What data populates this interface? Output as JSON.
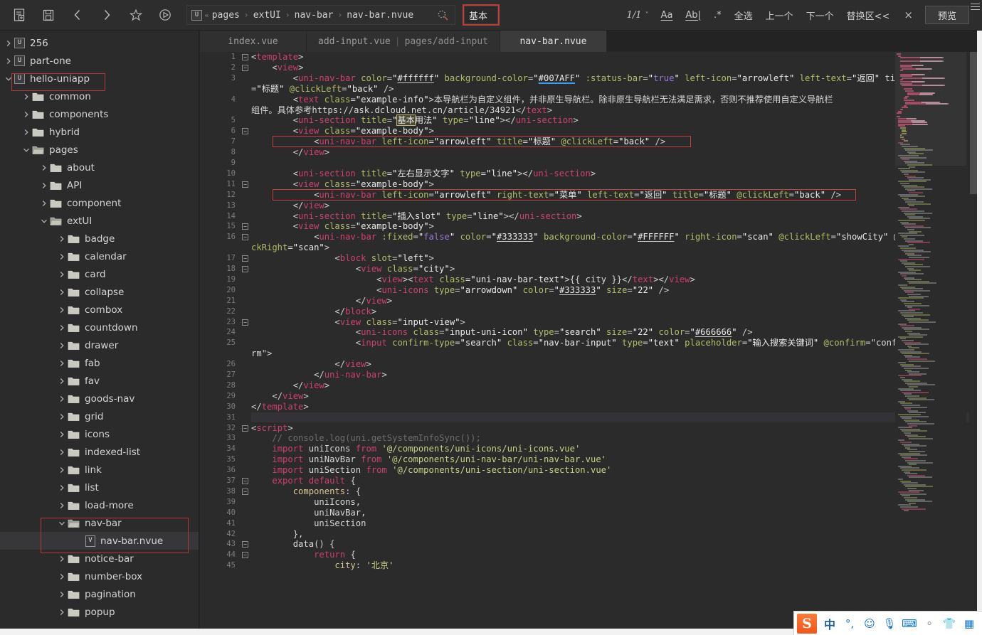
{
  "toolbar": {
    "icons": [
      {
        "name": "new-file-icon",
        "label": "新建"
      },
      {
        "name": "save-icon",
        "label": "保存"
      },
      {
        "name": "back-icon",
        "label": "后退"
      },
      {
        "name": "forward-icon",
        "label": "前进"
      },
      {
        "name": "star-icon",
        "label": "收藏"
      },
      {
        "name": "run-icon",
        "label": "运行"
      }
    ],
    "breadcrumb": {
      "logo": "U",
      "chevron": "«",
      "segments": [
        "pages",
        "extUI",
        "nav-bar",
        "nav-bar.nvue"
      ],
      "separator": "›",
      "search_icon": "search-icon"
    },
    "find": {
      "value": "基本",
      "placeholder": "",
      "match_count": "1/1",
      "caret": "˅",
      "case_label": "Aa",
      "word_label": "Ab|",
      "regex_label": ".*",
      "select_all_label": "全选",
      "prev_label": "上一个",
      "next_label": "下一个",
      "replace_label": "替换区<<",
      "close_label": "×"
    },
    "preview_label": "预览"
  },
  "tabs": [
    {
      "label": "index.vue",
      "active": false,
      "sub": ""
    },
    {
      "label": "add-input.vue",
      "active": false,
      "sub": "pages/add-input",
      "sep": "|"
    },
    {
      "label": "nav-bar.nvue",
      "active": true,
      "sub": ""
    }
  ],
  "sidebar": {
    "items": [
      {
        "label": "256",
        "depth": 0,
        "type": "project",
        "state": "collapsed"
      },
      {
        "label": "part-one",
        "depth": 0,
        "type": "project",
        "state": "collapsed"
      },
      {
        "label": "hello-uniapp",
        "depth": 0,
        "type": "project",
        "state": "expanded",
        "boxed": true
      },
      {
        "label": "common",
        "depth": 1,
        "type": "folder",
        "state": "collapsed"
      },
      {
        "label": "components",
        "depth": 1,
        "type": "folder",
        "state": "collapsed"
      },
      {
        "label": "hybrid",
        "depth": 1,
        "type": "folder",
        "state": "collapsed"
      },
      {
        "label": "pages",
        "depth": 1,
        "type": "folder",
        "state": "expanded"
      },
      {
        "label": "about",
        "depth": 2,
        "type": "folder",
        "state": "collapsed"
      },
      {
        "label": "API",
        "depth": 2,
        "type": "folder",
        "state": "collapsed"
      },
      {
        "label": "component",
        "depth": 2,
        "type": "folder",
        "state": "collapsed"
      },
      {
        "label": "extUI",
        "depth": 2,
        "type": "folder",
        "state": "expanded"
      },
      {
        "label": "badge",
        "depth": 3,
        "type": "folder",
        "state": "collapsed"
      },
      {
        "label": "calendar",
        "depth": 3,
        "type": "folder",
        "state": "collapsed"
      },
      {
        "label": "card",
        "depth": 3,
        "type": "folder",
        "state": "collapsed"
      },
      {
        "label": "collapse",
        "depth": 3,
        "type": "folder",
        "state": "collapsed"
      },
      {
        "label": "combox",
        "depth": 3,
        "type": "folder",
        "state": "collapsed"
      },
      {
        "label": "countdown",
        "depth": 3,
        "type": "folder",
        "state": "collapsed"
      },
      {
        "label": "drawer",
        "depth": 3,
        "type": "folder",
        "state": "collapsed"
      },
      {
        "label": "fab",
        "depth": 3,
        "type": "folder",
        "state": "collapsed"
      },
      {
        "label": "fav",
        "depth": 3,
        "type": "folder",
        "state": "collapsed"
      },
      {
        "label": "goods-nav",
        "depth": 3,
        "type": "folder",
        "state": "collapsed"
      },
      {
        "label": "grid",
        "depth": 3,
        "type": "folder",
        "state": "collapsed"
      },
      {
        "label": "icons",
        "depth": 3,
        "type": "folder",
        "state": "collapsed"
      },
      {
        "label": "indexed-list",
        "depth": 3,
        "type": "folder",
        "state": "collapsed"
      },
      {
        "label": "link",
        "depth": 3,
        "type": "folder",
        "state": "collapsed"
      },
      {
        "label": "list",
        "depth": 3,
        "type": "folder",
        "state": "collapsed"
      },
      {
        "label": "load-more",
        "depth": 3,
        "type": "folder",
        "state": "collapsed"
      },
      {
        "label": "nav-bar",
        "depth": 3,
        "type": "folder",
        "state": "expanded",
        "boxed": true
      },
      {
        "label": "nav-bar.nvue",
        "depth": 4,
        "type": "vuefile",
        "state": "none",
        "selected": true,
        "boxed": true
      },
      {
        "label": "notice-bar",
        "depth": 3,
        "type": "folder",
        "state": "collapsed"
      },
      {
        "label": "number-box",
        "depth": 3,
        "type": "folder",
        "state": "collapsed"
      },
      {
        "label": "pagination",
        "depth": 3,
        "type": "folder",
        "state": "collapsed"
      },
      {
        "label": "popup",
        "depth": 3,
        "type": "folder",
        "state": "collapsed"
      }
    ]
  },
  "editor": {
    "filename": "nav-bar.nvue",
    "language": "vue",
    "search_term": "基本",
    "lines": [
      {
        "n": 1,
        "fold": "minus",
        "text": "<template>"
      },
      {
        "n": 2,
        "fold": "minus",
        "text": "    <view>"
      },
      {
        "n": 3,
        "fold": "",
        "text": "        <uni-nav-bar color=\"#ffffff\" background-color=\"#007AFF\" :status-bar=\"true\" left-icon=\"arrowleft\" left-text=\"返回\" title=\"标题\" @clickLeft=\"back\" />"
      },
      {
        "n": 4,
        "fold": "",
        "text": "        <text class=\"example-info\">本导航栏为自定义组件，并非原生导航栏。除非原生导航栏无法满足需求，否则不推荐使用自定义导航栏组件。具体参考https://ask.dcloud.net.cn/article/34921</text>"
      },
      {
        "n": 5,
        "fold": "",
        "text": "        <uni-section title=\"基本用法\" type=\"line\"></uni-section>"
      },
      {
        "n": 6,
        "fold": "minus",
        "text": "        <view class=\"example-body\">"
      },
      {
        "n": 7,
        "fold": "",
        "text": "            <uni-nav-bar left-icon=\"arrowleft\" title=\"标题\" @clickLeft=\"back\" />"
      },
      {
        "n": 8,
        "fold": "",
        "text": "        </view>"
      },
      {
        "n": 9,
        "fold": "",
        "text": ""
      },
      {
        "n": 10,
        "fold": "",
        "text": "        <uni-section title=\"左右显示文字\" type=\"line\"></uni-section>"
      },
      {
        "n": 11,
        "fold": "minus",
        "text": "        <view class=\"example-body\">"
      },
      {
        "n": 12,
        "fold": "",
        "text": "            <uni-nav-bar left-icon=\"arrowleft\" right-text=\"菜单\" left-text=\"返回\" title=\"标题\" @clickLeft=\"back\" />"
      },
      {
        "n": 13,
        "fold": "",
        "text": "        </view>"
      },
      {
        "n": 14,
        "fold": "",
        "text": "        <uni-section title=\"插入slot\" type=\"line\"></uni-section>"
      },
      {
        "n": 15,
        "fold": "minus",
        "text": "        <view class=\"example-body\">"
      },
      {
        "n": 16,
        "fold": "minus",
        "text": "            <uni-nav-bar :fixed=\"false\" color=\"#333333\" background-color=\"#FFFFFF\" right-icon=\"scan\" @clickLeft=\"showCity\" @clickRight=\"scan\">"
      },
      {
        "n": 17,
        "fold": "minus",
        "text": "                <block slot=\"left\">"
      },
      {
        "n": 18,
        "fold": "minus",
        "text": "                    <view class=\"city\">"
      },
      {
        "n": 19,
        "fold": "",
        "text": "                        <view><text class=\"uni-nav-bar-text\">{{ city }}</text></view>"
      },
      {
        "n": 20,
        "fold": "",
        "text": "                        <uni-icons type=\"arrowdown\" color=\"#333333\" size=\"22\" />"
      },
      {
        "n": 21,
        "fold": "",
        "text": "                    </view>"
      },
      {
        "n": 22,
        "fold": "",
        "text": "                </block>"
      },
      {
        "n": 23,
        "fold": "minus",
        "text": "                <view class=\"input-view\">"
      },
      {
        "n": 24,
        "fold": "",
        "text": "                    <uni-icons class=\"input-uni-icon\" type=\"search\" size=\"22\" color=\"#666666\" />"
      },
      {
        "n": 25,
        "fold": "",
        "text": "                    <input confirm-type=\"search\" class=\"nav-bar-input\" type=\"text\" placeholder=\"输入搜索关键词\" @confirm=\"confirm\">"
      },
      {
        "n": 26,
        "fold": "",
        "text": "                </view>"
      },
      {
        "n": 27,
        "fold": "",
        "text": "            </uni-nav-bar>"
      },
      {
        "n": 28,
        "fold": "",
        "text": "        </view>"
      },
      {
        "n": 29,
        "fold": "",
        "text": "    </view>"
      },
      {
        "n": 30,
        "fold": "",
        "text": "</template>"
      },
      {
        "n": 31,
        "fold": "",
        "text": ""
      },
      {
        "n": 32,
        "fold": "minus",
        "text": "<script>"
      },
      {
        "n": 33,
        "fold": "",
        "text": "    // console.log(uni.getSystemInfoSync());"
      },
      {
        "n": 34,
        "fold": "",
        "text": "    import uniIcons from '@/components/uni-icons/uni-icons.vue'"
      },
      {
        "n": 35,
        "fold": "",
        "text": "    import uniNavBar from '@/components/uni-nav-bar/uni-nav-bar.vue'"
      },
      {
        "n": 36,
        "fold": "",
        "text": "    import uniSection from '@/components/uni-section/uni-section.vue'"
      },
      {
        "n": 37,
        "fold": "minus",
        "text": "    export default {"
      },
      {
        "n": 38,
        "fold": "minus",
        "text": "        components: {"
      },
      {
        "n": 39,
        "fold": "",
        "text": "            uniIcons,"
      },
      {
        "n": 40,
        "fold": "",
        "text": "            uniNavBar,"
      },
      {
        "n": 41,
        "fold": "",
        "text": "            uniSection"
      },
      {
        "n": 42,
        "fold": "",
        "text": "        },"
      },
      {
        "n": 43,
        "fold": "minus",
        "text": "        data() {"
      },
      {
        "n": 44,
        "fold": "minus",
        "text": "            return {"
      },
      {
        "n": 45,
        "fold": "",
        "text": "                city: '北京'"
      }
    ]
  },
  "ime": {
    "logo": "S",
    "items": [
      {
        "name": "chinese-mode-icon",
        "glyph": "中"
      },
      {
        "name": "punctuation-icon",
        "glyph": "°,"
      },
      {
        "name": "emoji-icon",
        "glyph": "☺"
      },
      {
        "name": "microphone-icon",
        "glyph": "🎙"
      },
      {
        "name": "keyboard-icon",
        "glyph": "⌨"
      },
      {
        "name": "user-icon",
        "glyph": "⚬"
      },
      {
        "name": "skin-icon",
        "glyph": "👕"
      },
      {
        "name": "toolbox-icon",
        "glyph": "▦"
      }
    ]
  },
  "colors": {
    "editor_bg": "#2b2b2b",
    "sidebar_bg": "#2b2b2b",
    "toolbar_bg": "#2d2d2d",
    "accent_red": "#c0423f",
    "tag": "#cf4070",
    "attr": "#b5bd68",
    "string": "#e8e8e8",
    "comment": "#6d6d6d",
    "selection": "#37373a"
  }
}
